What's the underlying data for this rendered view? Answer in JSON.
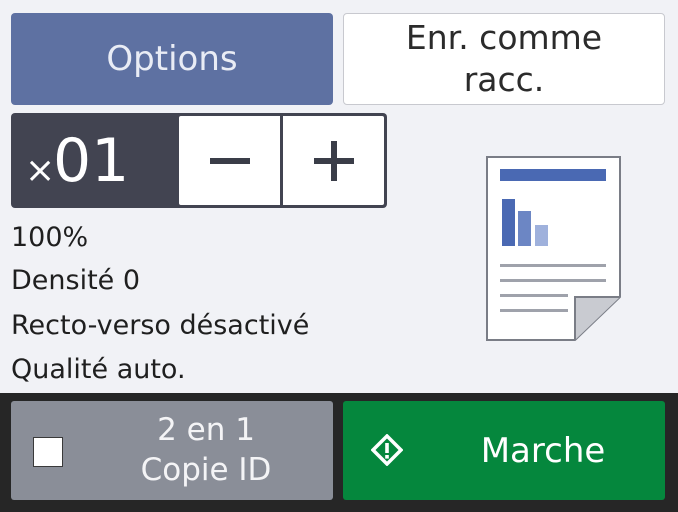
{
  "buttons": {
    "options": "Options",
    "save_shortcut_line1": "Enr. comme",
    "save_shortcut_line2": "racc."
  },
  "copies": {
    "multiplier": "×",
    "value": "01",
    "minus_icon": "minus-icon",
    "plus_icon": "plus-icon"
  },
  "settings": {
    "zoom": "100%",
    "density": "Densité 0",
    "duplex": "Recto-verso désactivé",
    "quality": "Qualité auto."
  },
  "bottom": {
    "id_copy_line1": "2 en 1",
    "id_copy_line2": "Copie ID",
    "id_copy_checked": false,
    "start": "Marche",
    "start_icon": "diamond-start-icon"
  },
  "colors": {
    "options_bg": "#5e71a2",
    "start_bg": "#05873d",
    "id_copy_bg": "#8a8e98",
    "stepper_bg": "#424451",
    "background": "#f1f2f6"
  }
}
